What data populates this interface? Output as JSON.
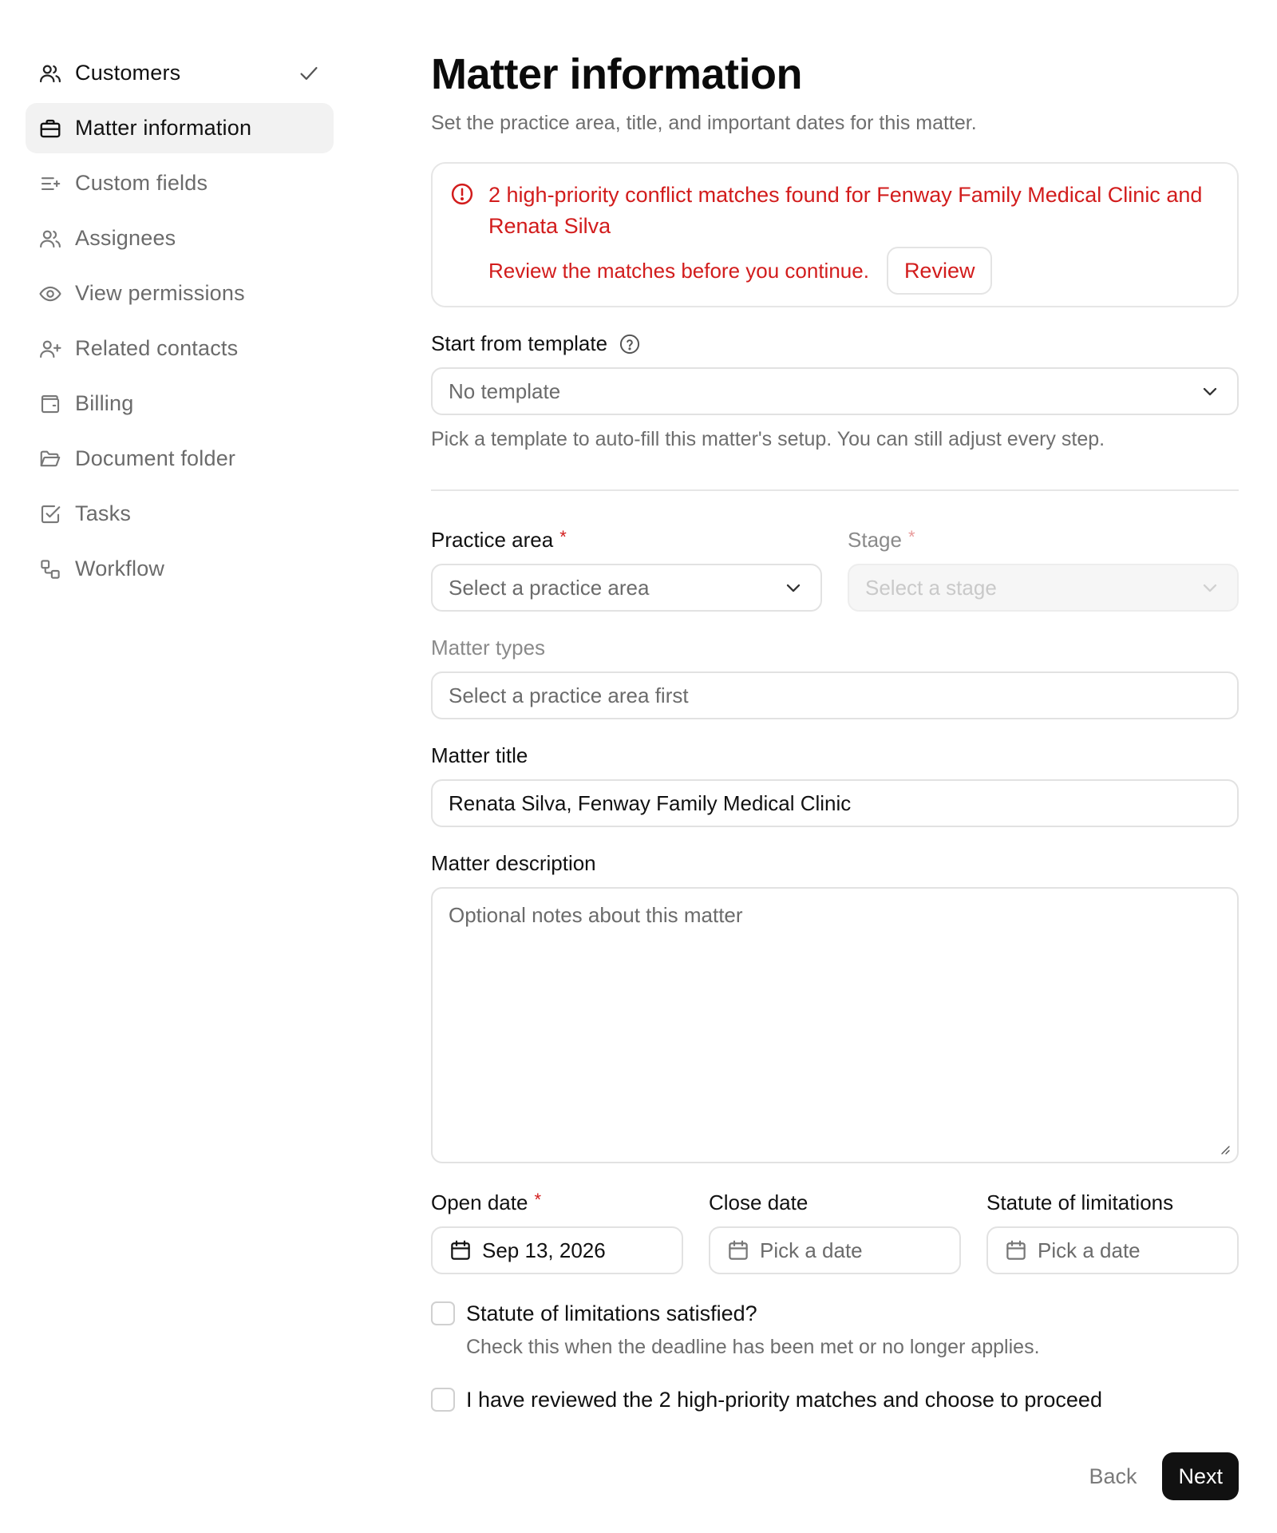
{
  "sidebar": {
    "items": [
      {
        "label": "Customers",
        "icon": "users-icon",
        "state": "done"
      },
      {
        "label": "Matter information",
        "icon": "briefcase-icon",
        "state": "active"
      },
      {
        "label": "Custom fields",
        "icon": "list-plus-icon",
        "state": "pending"
      },
      {
        "label": "Assignees",
        "icon": "users-icon",
        "state": "pending"
      },
      {
        "label": "View permissions",
        "icon": "eye-icon",
        "state": "pending"
      },
      {
        "label": "Related contacts",
        "icon": "user-plus-icon",
        "state": "pending"
      },
      {
        "label": "Billing",
        "icon": "wallet-icon",
        "state": "pending"
      },
      {
        "label": "Document folder",
        "icon": "folder-open-icon",
        "state": "pending"
      },
      {
        "label": "Tasks",
        "icon": "check-square-icon",
        "state": "pending"
      },
      {
        "label": "Workflow",
        "icon": "workflow-icon",
        "state": "pending"
      }
    ]
  },
  "header": {
    "title": "Matter information",
    "subtitle": "Set the practice area, title, and important dates for this matter."
  },
  "alert": {
    "title": "2 high-priority conflict matches found for Fenway Family Medical Clinic and Renata Silva",
    "text": "Review the matches before you continue.",
    "button": "Review",
    "color": "#d21c1c"
  },
  "template": {
    "label": "Start from template",
    "value": "No template",
    "hint": "Pick a template to auto-fill this matter's setup. You can still adjust every step."
  },
  "practice_area": {
    "label": "Practice area",
    "required": "*",
    "placeholder": "Select a practice area"
  },
  "stage": {
    "label": "Stage",
    "required": "*",
    "placeholder": "Select a stage"
  },
  "matter_types": {
    "label": "Matter types",
    "placeholder": "Select a practice area first"
  },
  "matter_title": {
    "label": "Matter title",
    "value": "Renata Silva, Fenway Family Medical Clinic"
  },
  "matter_description": {
    "label": "Matter description",
    "placeholder": "Optional notes about this matter"
  },
  "dates": {
    "open": {
      "label": "Open date",
      "required": "*",
      "value": "Sep 13, 2026"
    },
    "close": {
      "label": "Close date",
      "placeholder": "Pick a date"
    },
    "statute": {
      "label": "Statute of limitations",
      "placeholder": "Pick a date"
    }
  },
  "statute_satisfied": {
    "label": "Statute of limitations satisfied?",
    "hint": "Check this when the deadline has been met or no longer applies.",
    "checked": false
  },
  "acknowledge": {
    "label": "I have reviewed the 2 high-priority matches and choose to proceed",
    "checked": false
  },
  "footer": {
    "back": "Back",
    "next": "Next"
  },
  "colors": {
    "accent_dark": "#111111",
    "danger": "#d21c1c",
    "border": "#e2e2e2",
    "active_bg": "#f2f2f2"
  }
}
